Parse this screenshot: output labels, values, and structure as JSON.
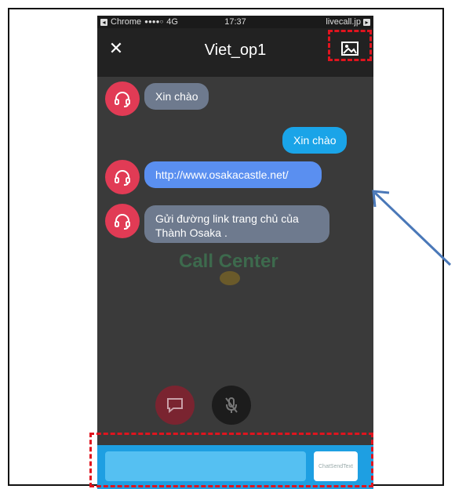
{
  "status_bar": {
    "left_app": "Chrome",
    "signal": "●●●●○",
    "network": "4G",
    "time": "17:37",
    "right_site": "livecall.jp"
  },
  "header": {
    "close_label": "✕",
    "title": "Viet_op1"
  },
  "messages": [
    {
      "side": "left",
      "text": "Xin chào"
    },
    {
      "side": "right",
      "text": "Xin chào"
    },
    {
      "side": "left",
      "text": "http://www.osakacastle.net/"
    },
    {
      "side": "left",
      "text": "Gửi đường link trang chủ của Thành Osaka ."
    }
  ],
  "background": {
    "watermark_text": "Call Center"
  },
  "composer": {
    "input_value": "",
    "send_label": "ChatSendText"
  },
  "colors": {
    "avatar": "#e13b55",
    "bubble_operator": "#6e7a8e",
    "bubble_link": "#5a8ff0",
    "bubble_user": "#1aa4e8",
    "composer_bar": "#1e9fe2",
    "highlight": "#e0141e",
    "arrow": "#4a78b8"
  },
  "icons": [
    "close-icon",
    "image-icon",
    "headset-icon",
    "chat-icon",
    "mic-off-icon"
  ]
}
